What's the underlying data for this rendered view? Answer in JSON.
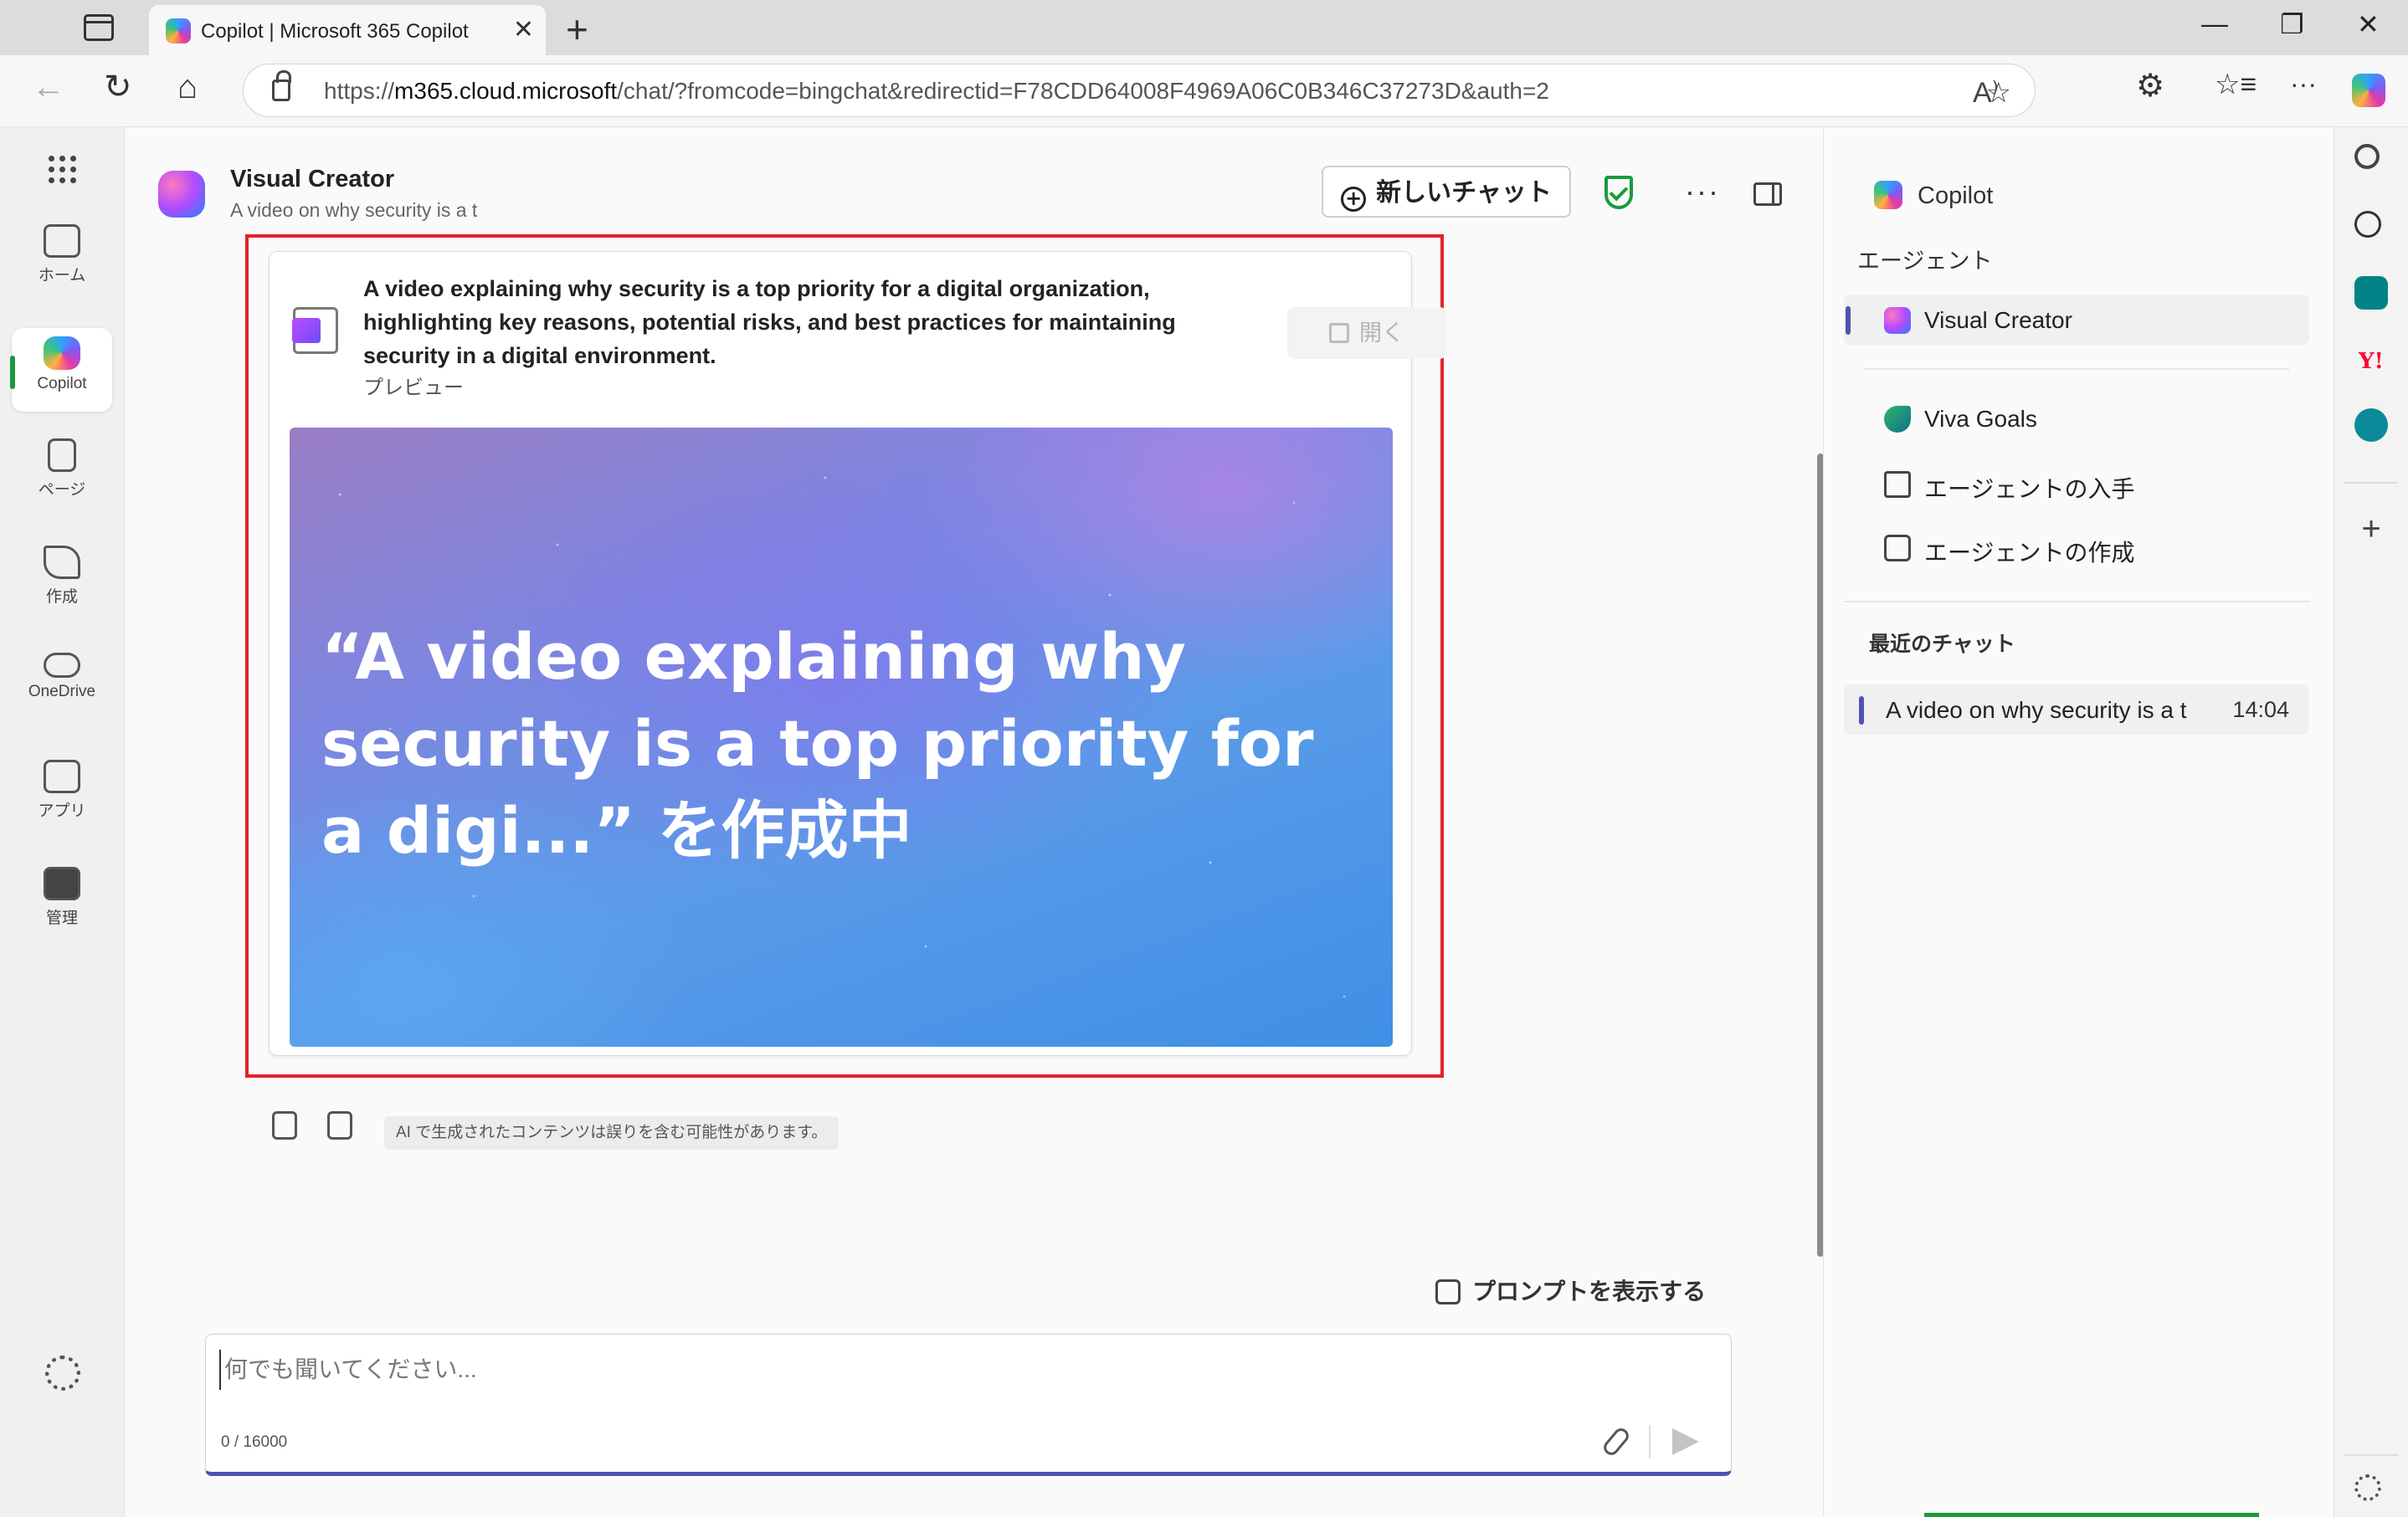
{
  "browser": {
    "tab_title": "Copilot | Microsoft 365 Copilot",
    "tab_close": "✕",
    "new_tab": "+",
    "url_prefix": "https://",
    "url_host": "m365.cloud.microsoft",
    "url_rest": "/chat/?fromcode=bingchat&redirectid=F78CDD64008F4969A06C0B346C37273D&auth=2",
    "window_minimize": "—",
    "window_maximize": "❐",
    "window_close": "✕",
    "nav_back": "←",
    "nav_refresh": "↻",
    "nav_home": "⌂",
    "read_aloud": "A⁾",
    "favorite": "☆",
    "extensions": "⚙",
    "favorites_list": "☆≡",
    "menu": "···"
  },
  "rail": {
    "items": [
      {
        "label": "ホーム"
      },
      {
        "label": "Copilot"
      },
      {
        "label": "ページ"
      },
      {
        "label": "作成"
      },
      {
        "label": "OneDrive"
      },
      {
        "label": "アプリ"
      },
      {
        "label": "管理"
      }
    ]
  },
  "header": {
    "agent_name": "Visual Creator",
    "agent_subtitle": "A video on why security is a t",
    "new_chat_label": "新しいチャット",
    "more": "···"
  },
  "card": {
    "description": "A video explaining why security is a top priority for a digital organization, highlighting key reasons, potential risks, and best practices for maintaining security in a digital environment.",
    "preview_label": "プレビュー",
    "open_label": "開く",
    "video_caption": "“A video explaining why security is a top priority for a digi...” を作成中"
  },
  "feedback": {
    "ai_notice": "AI で生成されたコンテンツは誤りを含む可能性があります。"
  },
  "composer": {
    "show_prompts_label": "プロンプトを表示する",
    "placeholder": "何でも聞いてください...",
    "char_count": "0 / 16000"
  },
  "sidepanel": {
    "copilot_label": "Copilot",
    "agents_heading": "エージェント",
    "agents": [
      {
        "label": "Visual Creator",
        "active": true
      },
      {
        "label": "Viva Goals",
        "active": false
      },
      {
        "label": "エージェントの入手",
        "active": false
      },
      {
        "label": "エージェントの作成",
        "active": false
      }
    ],
    "recent_heading": "最近のチャット",
    "recent": [
      {
        "label": "A video on why security is a t",
        "time": "14:04"
      }
    ]
  },
  "edgebar": {
    "add_label": "+"
  }
}
